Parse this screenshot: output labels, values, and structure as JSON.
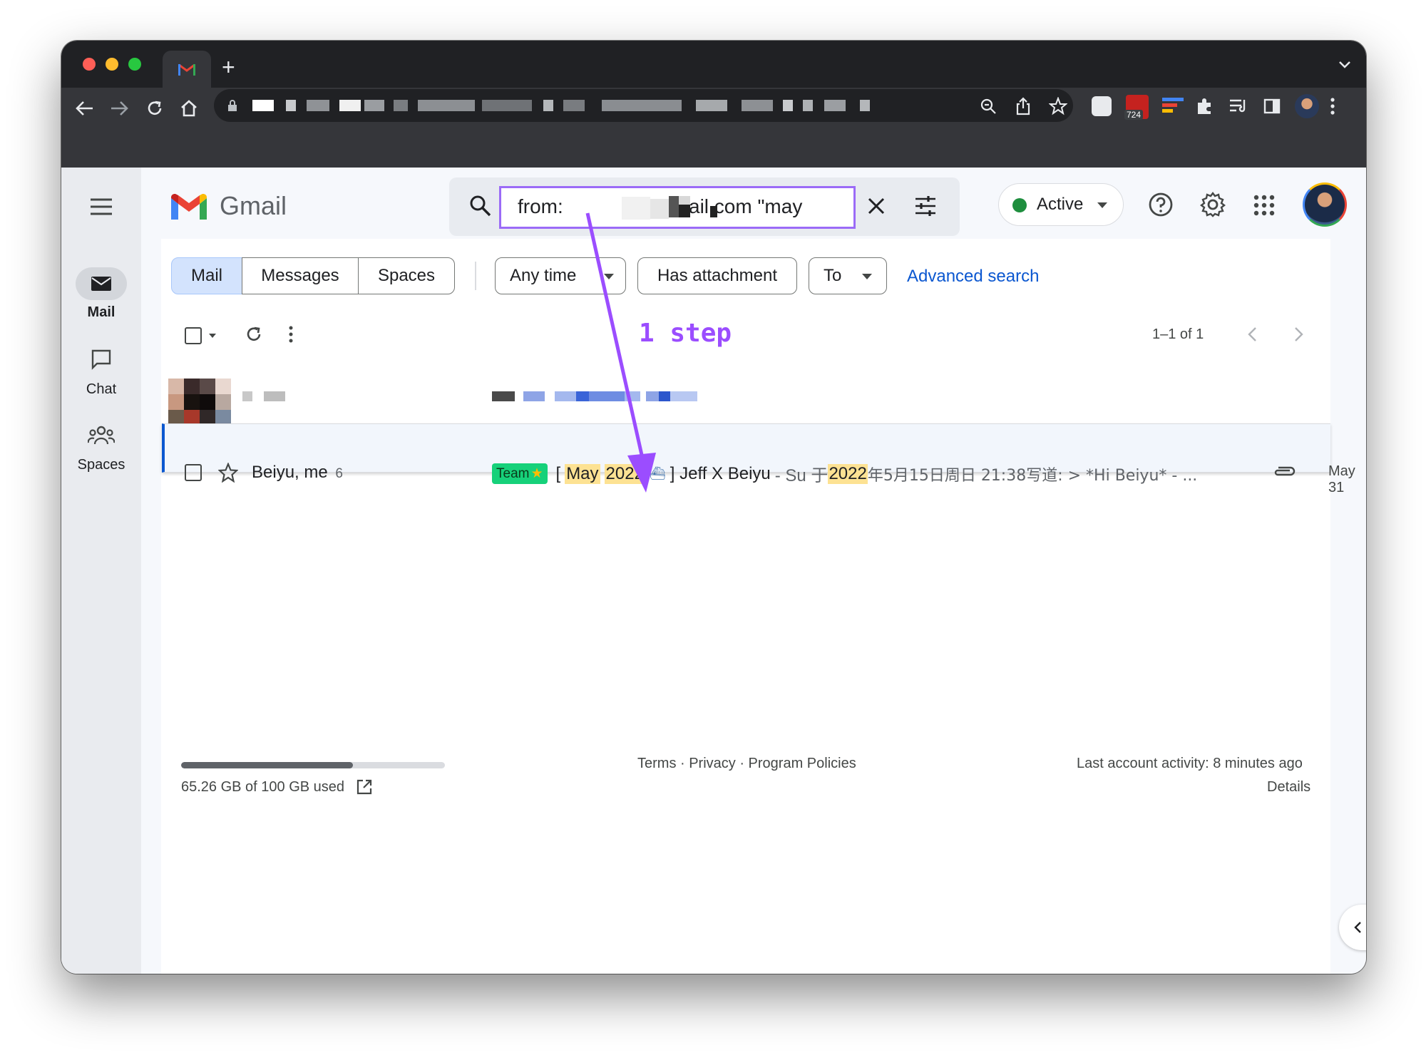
{
  "browser": {
    "new_tab_symbol": "+",
    "ext_badge_count": "724"
  },
  "gmail": {
    "logo_text": "Gmail",
    "search": {
      "query": "from:              @gmail.com \"may"
    },
    "status": {
      "label": "Active",
      "color": "#1e8e3e"
    }
  },
  "rail": {
    "mail": "Mail",
    "chat": "Chat",
    "spaces": "Spaces"
  },
  "filters": {
    "tabs": [
      "Mail",
      "Messages",
      "Spaces"
    ],
    "any_time": "Any time",
    "has_attachment": "Has attachment",
    "to": "To",
    "advanced_search": "Advanced search"
  },
  "annotation": {
    "text": "1 step",
    "color": "#9b4dff"
  },
  "list": {
    "pagination": "1–1 of 1",
    "rows": [
      {
        "sender": "Beiyu, me",
        "count": "6",
        "label": "Team",
        "subject_open": "[",
        "subject_hl1": "May",
        "subject_hl2": "2022",
        "subject_close": "] Jeff X Beiyu",
        "snippet_pre": "- Su 于",
        "snippet_hl": "2022",
        "snippet_post": "年5月15日周日 21:38写道:  > *Hi Beiyu* - ...",
        "date": "May 31"
      }
    ]
  },
  "footer": {
    "storage_text": "65.26 GB of 100 GB used",
    "storage_fraction": 0.6526,
    "links": "Terms · Privacy · Program Policies",
    "last_activity": "Last account activity: 8 minutes ago",
    "details": "Details"
  }
}
